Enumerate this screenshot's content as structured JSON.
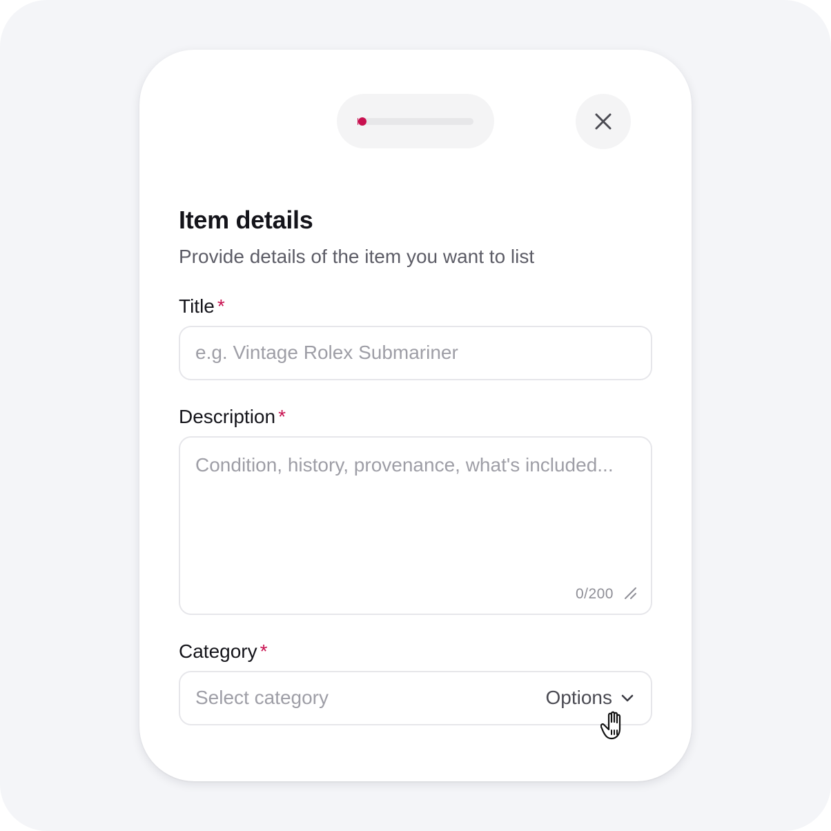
{
  "modal": {
    "progress": 0.04,
    "accent_color": "#c8104f",
    "close_icon": "close-icon"
  },
  "header": {
    "title": "Item details",
    "subtitle": "Provide details of the item you want to list"
  },
  "form": {
    "title_field": {
      "label": "Title",
      "required_mark": "*",
      "placeholder": "e.g. Vintage Rolex Submariner",
      "value": ""
    },
    "description_field": {
      "label": "Description",
      "required_mark": "*",
      "placeholder": "Condition, history, provenance, what's included...",
      "value": "",
      "counter": "0/200"
    },
    "category_field": {
      "label": "Category",
      "required_mark": "*",
      "placeholder": "Select category",
      "options_label": "Options",
      "options_icon": "chevron-down-icon"
    }
  },
  "pointer": {
    "icon": "hand-pointer-icon"
  }
}
